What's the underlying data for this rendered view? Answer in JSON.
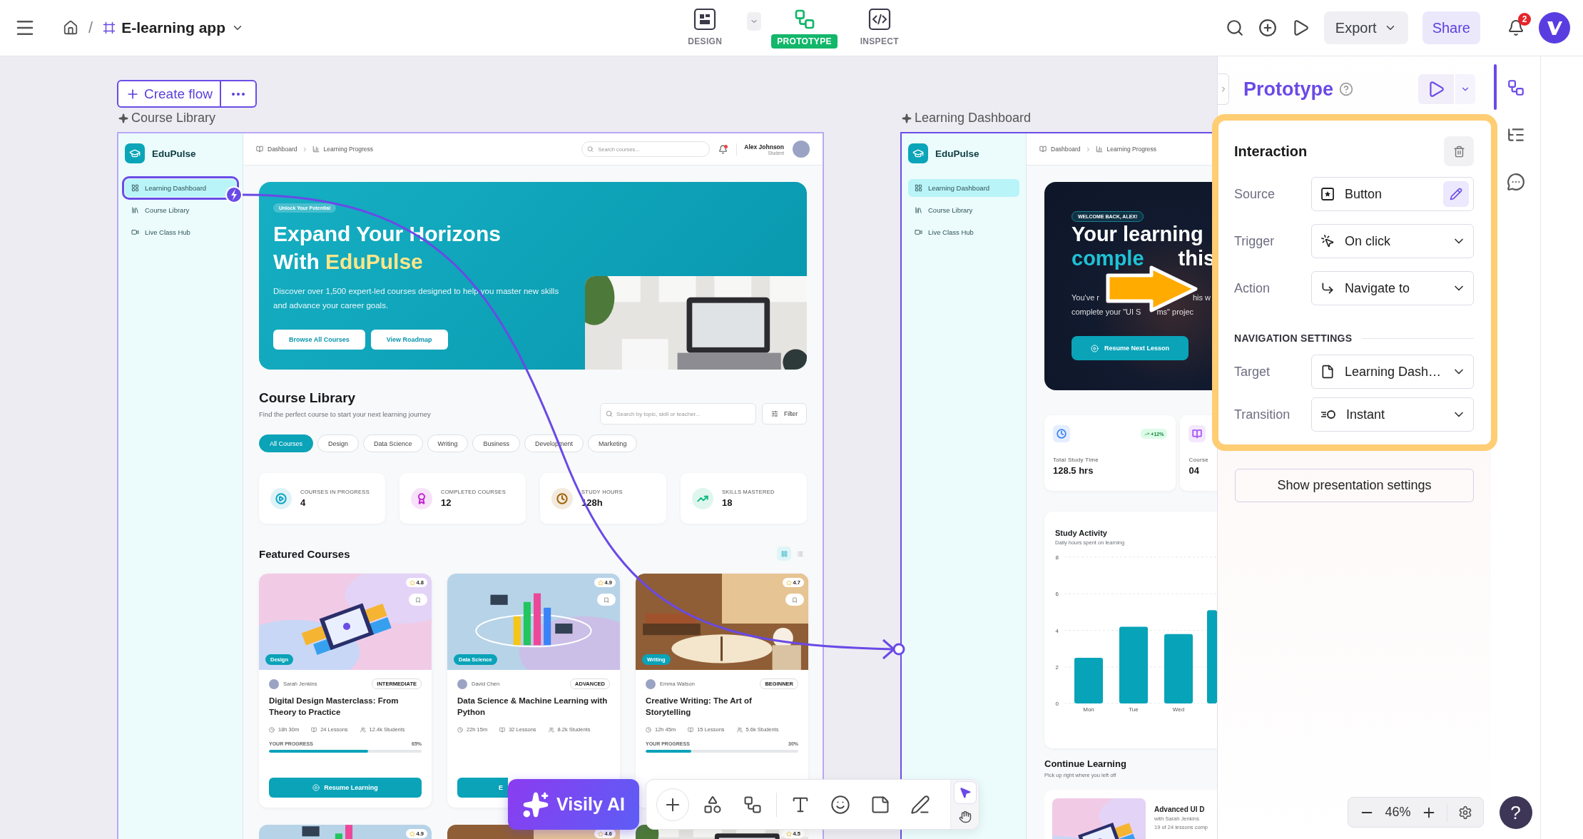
{
  "topbar": {
    "separator": "/",
    "project": "E-learning app",
    "modes": [
      {
        "kind": "design",
        "label": "DESIGN",
        "selected": false
      },
      {
        "kind": "prototype",
        "label": "PROTOTYPE",
        "selected": true
      },
      {
        "kind": "inspect",
        "label": "INSPECT",
        "selected": false
      }
    ],
    "export": "Export",
    "share": "Share",
    "notification_count": "2"
  },
  "canvas": {
    "create_flow": "Create flow",
    "frames": [
      {
        "kind": "library",
        "title": "Course Library",
        "brand": "EduPulse",
        "nav": [
          {
            "label": "Learning Dashboard",
            "selected": true,
            "interaction_source": true
          },
          {
            "label": "Course Library",
            "selected": false,
            "interaction_source": false
          },
          {
            "label": "Live Class Hub",
            "selected": false,
            "interaction_source": false
          }
        ],
        "breadcrumb": [
          "Dashboard",
          "Learning Progress"
        ],
        "search": {
          "placeholder": "Search courses..."
        },
        "user": {
          "name": "Alex Johnson",
          "role": "Student"
        },
        "hero": {
          "badge": "Unlock Your Potential",
          "title": "Expand Your Horizons",
          "title_line2": "With",
          "highlight": "EduPulse",
          "text": "Discover over 1,500 expert-led courses designed to help you master new skills and advance your career goals.",
          "buttons": [
            "Browse All Courses",
            "View Roadmap"
          ]
        },
        "library": {
          "title": "Course Library",
          "subtitle": "Find the perfect course to start your next learning journey",
          "search": {
            "placeholder": "Search by topic, skill or teacher..."
          },
          "filter": "Filter",
          "chips": [
            {
              "label": "All Courses",
              "selected": true
            },
            {
              "label": "Design",
              "selected": false
            },
            {
              "label": "Data Science",
              "selected": false
            },
            {
              "label": "Writing",
              "selected": false
            },
            {
              "label": "Business",
              "selected": false
            },
            {
              "label": "Development",
              "selected": false
            },
            {
              "label": "Marketing",
              "selected": false
            }
          ]
        },
        "stats": [
          {
            "kind": "play",
            "label": "COURSES IN PROGRESS",
            "value": "4",
            "color": "#0ea5c6"
          },
          {
            "kind": "award",
            "label": "COMPLETED COURSES",
            "value": "12",
            "color": "#c026d3"
          },
          {
            "kind": "clock",
            "label": "STUDY HOURS",
            "value": "128h",
            "color": "#a16207"
          },
          {
            "kind": "trend",
            "label": "SKILLS MASTERED",
            "value": "18",
            "color": "#10b981"
          }
        ],
        "featured": {
          "title": "Featured Courses",
          "views": [
            {
              "kind": "grid",
              "selected": true
            },
            {
              "kind": "list",
              "selected": false
            }
          ]
        },
        "courses": [
          {
            "rating": "4.8",
            "tag": "Design",
            "author": "Sarah Jenkins",
            "level": "INTERMEDIATE",
            "title": "Digital Design Masterclass: From Theory to Practice",
            "duration": "18h 30m",
            "lessons": "24 Lessons",
            "students": "12.4k Students",
            "progress": {
              "label": "YOUR PROGRESS",
              "reading": "65%",
              "level": 0.65
            },
            "button": "Resume Learning"
          },
          {
            "rating": "4.9",
            "tag": "Data Science",
            "author": "David Chen",
            "level": "ADVANCED",
            "title": "Data Science & Machine Learning with Python",
            "duration": "22h 15m",
            "lessons": "32 Lessons",
            "students": "8.2k Students",
            "button": "E"
          },
          {
            "rating": "4.7",
            "tag": "Writing",
            "author": "Emma Watson",
            "level": "BEGINNER",
            "title": "Creative Writing: The Art of Storytelling",
            "duration": "12h 45m",
            "lessons": "15 Lessons",
            "students": "5.6k Students",
            "progress": {
              "label": "YOUR PROGRESS",
              "reading": "30%",
              "level": 0.3
            }
          }
        ],
        "more_courses": [
          {
            "rating": "4.9"
          },
          {
            "rating": "4.6"
          },
          {
            "rating": "4.5"
          }
        ]
      },
      {
        "kind": "dashboard",
        "title": "Learning Dashboard",
        "brand": "EduPulse",
        "nav": [
          {
            "label": "Learning Dashboard",
            "selected": true,
            "interaction_source": false
          },
          {
            "label": "Course Library",
            "selected": false,
            "interaction_source": false
          },
          {
            "label": "Live Class Hub",
            "selected": false,
            "interaction_source": false
          }
        ],
        "breadcrumb": [
          "Dashboard",
          "Learning Progress"
        ],
        "hero": {
          "badge": "WELCOME BACK, ALEX!",
          "title": "Your learning",
          "title_line2_parts": [
            "comple",
            "this"
          ],
          "text_lines": [
            [
              "You've r",
              "his w"
            ],
            [
              "complete your \"UI S",
              "ms\" projec"
            ]
          ],
          "button": "Resume Next Lesson"
        },
        "stats": [
          {
            "kind": "clock",
            "label": "Total Study Time",
            "value": "128.5 hrs",
            "change": "+12%",
            "color": "#3b82f6"
          },
          {
            "kind": "book",
            "label": "Course",
            "value": "04",
            "color": "#a855f7"
          }
        ],
        "activity": {
          "title": "Study Activity",
          "subtitle": "Daily hours spent on learning",
          "chart_data": {
            "type": "bar",
            "categories": [
              "Mon",
              "Tue",
              "Wed",
              null
            ],
            "values": [
              2.5,
              4.2,
              3.8,
              5.1
            ],
            "ylim": [
              0,
              8
            ],
            "yticks": [
              0,
              2,
              4,
              6,
              8
            ],
            "grid": true
          }
        },
        "continue": {
          "title": "Continue Learning",
          "subtitle": "Pick up right where you left off",
          "course": {
            "title": "Advanced UI D",
            "instructor": "with Sarah Jenkins",
            "progress_text": "19 of 24 lessons comp"
          }
        }
      }
    ]
  },
  "toolbar": {
    "ai_button": "Visily AI",
    "tools": [
      {
        "kind": "add"
      },
      {
        "kind": "shapes"
      },
      {
        "kind": "flow"
      },
      {
        "kind": "text"
      },
      {
        "kind": "emoji"
      },
      {
        "kind": "note"
      },
      {
        "kind": "pen"
      }
    ],
    "pointer_modes": [
      {
        "kind": "select",
        "selected": true
      },
      {
        "kind": "hand",
        "selected": false
      }
    ]
  },
  "panel": {
    "title": "Prototype",
    "interaction": {
      "title": "Interaction",
      "rows": [
        {
          "kind": "source",
          "label": "Source",
          "value": "Button"
        },
        {
          "kind": "trigger",
          "label": "Trigger",
          "value": "On click"
        },
        {
          "kind": "action",
          "label": "Action",
          "value": "Navigate to"
        }
      ],
      "section": "NAVIGATION SETTINGS",
      "settings": [
        {
          "kind": "target",
          "label": "Target",
          "value": "Learning Dash…"
        },
        {
          "kind": "transition",
          "label": "Transition",
          "value": "Instant"
        }
      ]
    },
    "presentation_button": "Show presentation settings",
    "zoom": "46%",
    "rail": [
      {
        "kind": "prototype",
        "selected": true
      },
      {
        "kind": "layers",
        "selected": false
      },
      {
        "kind": "comments",
        "selected": false
      }
    ],
    "help": "?"
  }
}
